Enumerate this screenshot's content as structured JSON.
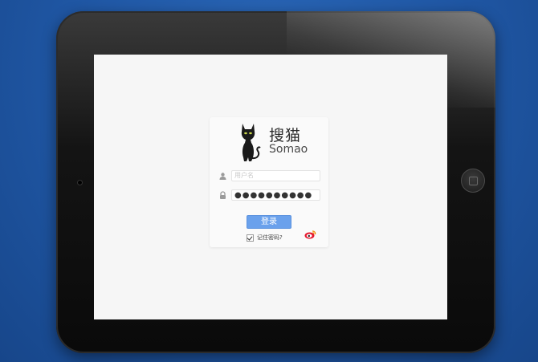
{
  "login": {
    "brand_name": "搜猫",
    "brand_name_en": "Somao",
    "username_placeholder": "用户名",
    "password_value": "●●●●●●●●●●",
    "login_button_label": "登录",
    "remember_label": "记住密码?",
    "remember_checked": true
  },
  "icons": {
    "logo": "black-cat-icon",
    "username": "user-icon",
    "password": "lock-icon",
    "social": "weibo-icon"
  },
  "colors": {
    "background": "#1f56a3",
    "button": "#6aa1ec",
    "weibo": "#e6162d"
  }
}
